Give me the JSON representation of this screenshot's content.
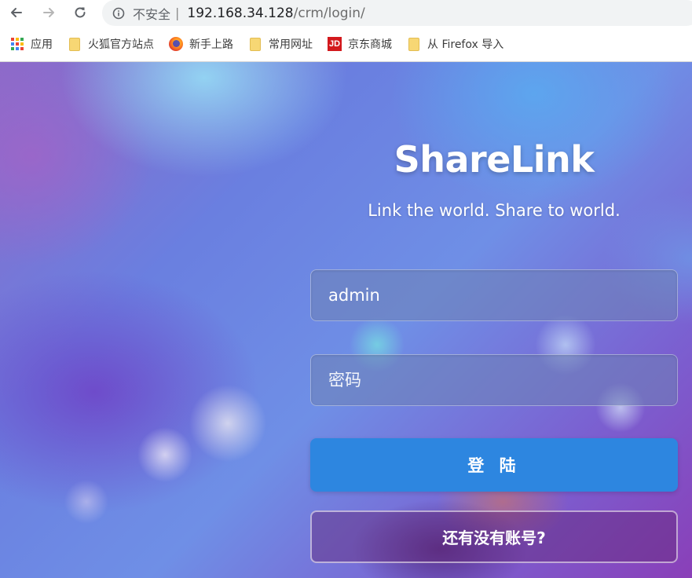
{
  "browser": {
    "security_label": "不安全",
    "separator": "|",
    "url_host": "192.168.34.128",
    "url_path": "/crm/login/",
    "bookmarks": [
      {
        "label": "应用",
        "icon": "apps-grid-icon"
      },
      {
        "label": "火狐官方站点",
        "icon": "folder-icon"
      },
      {
        "label": "新手上路",
        "icon": "firefox-icon"
      },
      {
        "label": "常用网址",
        "icon": "folder-icon"
      },
      {
        "label": "京东商城",
        "icon": "jd-icon",
        "icon_text": "JD"
      },
      {
        "label": "从 Firefox 导入",
        "icon": "folder-icon"
      }
    ]
  },
  "login": {
    "brand": "ShareLink",
    "tagline": "Link the world. Share to world.",
    "username_value": "admin",
    "password_placeholder": "密码",
    "login_button": "登 陆",
    "register_button": "还有没有账号?"
  },
  "colors": {
    "primary_button": "#2d86e0",
    "secondary_button_bg": "#642878",
    "address_bar_bg": "#f1f3f4"
  }
}
